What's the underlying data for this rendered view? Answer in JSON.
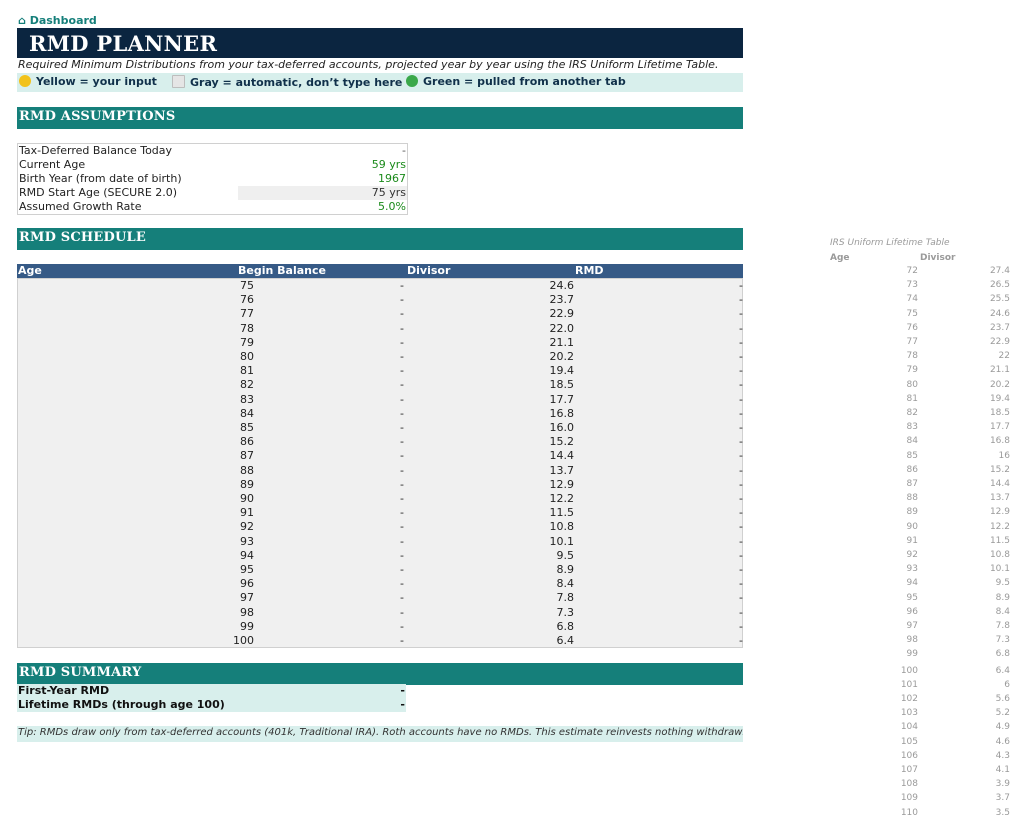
{
  "nav": {
    "dashboard_label": "⌂ Dashboard"
  },
  "header": {
    "title": "RMD PLANNER",
    "subtitle": "Required Minimum Distributions from your tax-deferred accounts, projected year by year using the IRS Uniform Lifetime Table."
  },
  "legend": {
    "yellow": "Yellow = your input",
    "gray": "Gray = automatic, don’t type here",
    "green": "Green = pulled from another tab"
  },
  "colors": {
    "navy": "#0b2540",
    "teal": "#157f7a",
    "table_header": "#365a86",
    "light_teal": "#d8efec",
    "input_green": "#1a8a1a"
  },
  "assumptions": {
    "heading": "RMD ASSUMPTIONS",
    "rows": [
      {
        "label": "Tax-Deferred Balance Today",
        "value": "-"
      },
      {
        "label": "Current Age",
        "value": "59 yrs"
      },
      {
        "label": "Birth Year (from date of birth)",
        "value": "1967"
      },
      {
        "label": "RMD Start Age (SECURE 2.0)",
        "value": "75 yrs"
      },
      {
        "label": "Assumed Growth Rate",
        "value": "5.0%"
      }
    ]
  },
  "schedule": {
    "heading": "RMD SCHEDULE",
    "columns": [
      "Age",
      "Begin Balance",
      "Divisor",
      "RMD"
    ],
    "rows": [
      [
        "75",
        "-",
        "24.6",
        "-"
      ],
      [
        "76",
        "-",
        "23.7",
        "-"
      ],
      [
        "77",
        "-",
        "22.9",
        "-"
      ],
      [
        "78",
        "-",
        "22.0",
        "-"
      ],
      [
        "79",
        "-",
        "21.1",
        "-"
      ],
      [
        "80",
        "-",
        "20.2",
        "-"
      ],
      [
        "81",
        "-",
        "19.4",
        "-"
      ],
      [
        "82",
        "-",
        "18.5",
        "-"
      ],
      [
        "83",
        "-",
        "17.7",
        "-"
      ],
      [
        "84",
        "-",
        "16.8",
        "-"
      ],
      [
        "85",
        "-",
        "16.0",
        "-"
      ],
      [
        "86",
        "-",
        "15.2",
        "-"
      ],
      [
        "87",
        "-",
        "14.4",
        "-"
      ],
      [
        "88",
        "-",
        "13.7",
        "-"
      ],
      [
        "89",
        "-",
        "12.9",
        "-"
      ],
      [
        "90",
        "-",
        "12.2",
        "-"
      ],
      [
        "91",
        "-",
        "11.5",
        "-"
      ],
      [
        "92",
        "-",
        "10.8",
        "-"
      ],
      [
        "93",
        "-",
        "10.1",
        "-"
      ],
      [
        "94",
        "-",
        "9.5",
        "-"
      ],
      [
        "95",
        "-",
        "8.9",
        "-"
      ],
      [
        "96",
        "-",
        "8.4",
        "-"
      ],
      [
        "97",
        "-",
        "7.8",
        "-"
      ],
      [
        "98",
        "-",
        "7.3",
        "-"
      ],
      [
        "99",
        "-",
        "6.8",
        "-"
      ],
      [
        "100",
        "-",
        "6.4",
        "-"
      ]
    ]
  },
  "summary": {
    "heading": "RMD SUMMARY",
    "first_year_label": "First-Year RMD",
    "first_year_value": "-",
    "lifetime_label": "Lifetime RMDs (through age 100)",
    "lifetime_value": "-"
  },
  "tip": "Tip: RMDs draw only from tax-deferred accounts (401k, Traditional IRA). Roth accounts have no RMDs. This estimate reinvests nothing withdrawn.",
  "irs_table": {
    "title": "IRS Uniform Lifetime Table",
    "col_age": "Age",
    "col_divisor": "Divisor",
    "rows": [
      [
        "72",
        "27.4"
      ],
      [
        "73",
        "26.5"
      ],
      [
        "74",
        "25.5"
      ],
      [
        "75",
        "24.6"
      ],
      [
        "76",
        "23.7"
      ],
      [
        "77",
        "22.9"
      ],
      [
        "78",
        "22"
      ],
      [
        "79",
        "21.1"
      ],
      [
        "80",
        "20.2"
      ],
      [
        "81",
        "19.4"
      ],
      [
        "82",
        "18.5"
      ],
      [
        "83",
        "17.7"
      ],
      [
        "84",
        "16.8"
      ],
      [
        "85",
        "16"
      ],
      [
        "86",
        "15.2"
      ],
      [
        "87",
        "14.4"
      ],
      [
        "88",
        "13.7"
      ],
      [
        "89",
        "12.9"
      ],
      [
        "90",
        "12.2"
      ],
      [
        "91",
        "11.5"
      ],
      [
        "92",
        "10.8"
      ],
      [
        "93",
        "10.1"
      ],
      [
        "94",
        "9.5"
      ],
      [
        "95",
        "8.9"
      ],
      [
        "96",
        "8.4"
      ],
      [
        "97",
        "7.8"
      ],
      [
        "98",
        "7.3"
      ],
      [
        "99",
        "6.8"
      ],
      [
        "100",
        "6.4"
      ],
      [
        "101",
        "6"
      ],
      [
        "102",
        "5.6"
      ],
      [
        "103",
        "5.2"
      ],
      [
        "104",
        "4.9"
      ],
      [
        "105",
        "4.6"
      ],
      [
        "106",
        "4.3"
      ],
      [
        "107",
        "4.1"
      ],
      [
        "108",
        "3.9"
      ],
      [
        "109",
        "3.7"
      ],
      [
        "110",
        "3.5"
      ]
    ]
  }
}
